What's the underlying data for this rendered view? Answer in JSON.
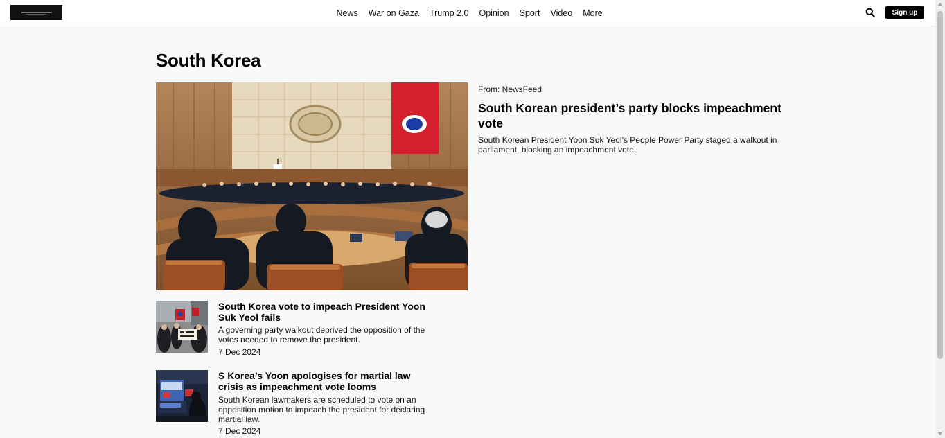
{
  "header": {
    "logo_alt": "Al Jazeera",
    "nav": [
      {
        "label": "News"
      },
      {
        "label": "War on Gaza"
      },
      {
        "label": "Trump 2.0"
      },
      {
        "label": "Opinion"
      },
      {
        "label": "Sport"
      },
      {
        "label": "Video"
      },
      {
        "label": "More"
      }
    ],
    "search_icon": "search-icon",
    "signup_label": "Sign up"
  },
  "page": {
    "title": "South Korea"
  },
  "featured": {
    "source": "From: NewsFeed",
    "title": "South Korean president’s party blocks impeachment vote",
    "summary": "South Korean President Yoon Suk Yeol’s People Power Party staged a walkout in parliament, blocking an impeachment vote.",
    "image": "parliament-chamber-photo"
  },
  "stories": [
    {
      "title": "South Korea vote to impeach President Yoon Suk Yeol fails",
      "summary": "A governing party walkout deprived the opposition of the votes needed to remove the president.",
      "date": "7 Dec 2024",
      "image": "protest-photo"
    },
    {
      "title": "S Korea’s Yoon apologises for martial law crisis as impeachment vote looms",
      "summary": "South Korean lawmakers are scheduled to vote on an opposition motion to impeach the president for declaring martial law.",
      "date": "7 Dec 2024",
      "image": "tv-broadcast-photo"
    }
  ],
  "colors": {
    "background": "#f9f9f9",
    "header_bg": "#ffffff",
    "button_bg": "#000000",
    "button_text": "#ffffff"
  }
}
